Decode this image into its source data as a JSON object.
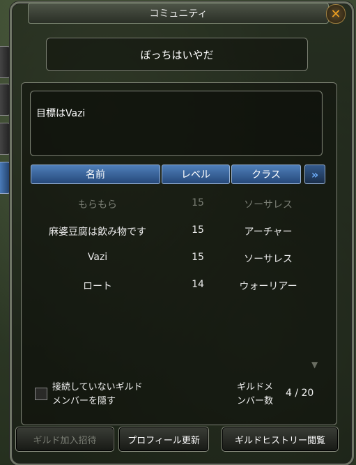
{
  "window": {
    "title": "コミュニティ",
    "close_glyph": "✕"
  },
  "guild": {
    "name": "ぼっちはいやだ",
    "motto": "目標はVazi"
  },
  "table": {
    "headers": {
      "name": "名前",
      "level": "レベル",
      "class": "クラス"
    },
    "more_glyph": "»",
    "rows": [
      {
        "name": "もらもら",
        "level": "15",
        "class": "ソーサレス",
        "online": false
      },
      {
        "name": "麻婆豆腐は飲み物です",
        "level": "15",
        "class": "アーチャー",
        "online": true
      },
      {
        "name": "Vazi",
        "level": "15",
        "class": "ソーサレス",
        "online": true
      },
      {
        "name": "ロート",
        "level": "14",
        "class": "ウォーリアー",
        "online": true
      }
    ]
  },
  "footer": {
    "hide_offline_line1": "接続していないギルド",
    "hide_offline_line2": "メンバーを隠す",
    "member_count_line1": "ギルドメ",
    "member_count_line2": "ンバー数",
    "member_count": "4 / 20"
  },
  "buttons": {
    "invite": "ギルド加入招待",
    "update_profile": "プロフィール更新",
    "history": "ギルドヒストリー閲覧"
  },
  "colors": {
    "accent": "#4f7fba",
    "offline_text": "#7a7e74",
    "close": "#f0a020"
  }
}
